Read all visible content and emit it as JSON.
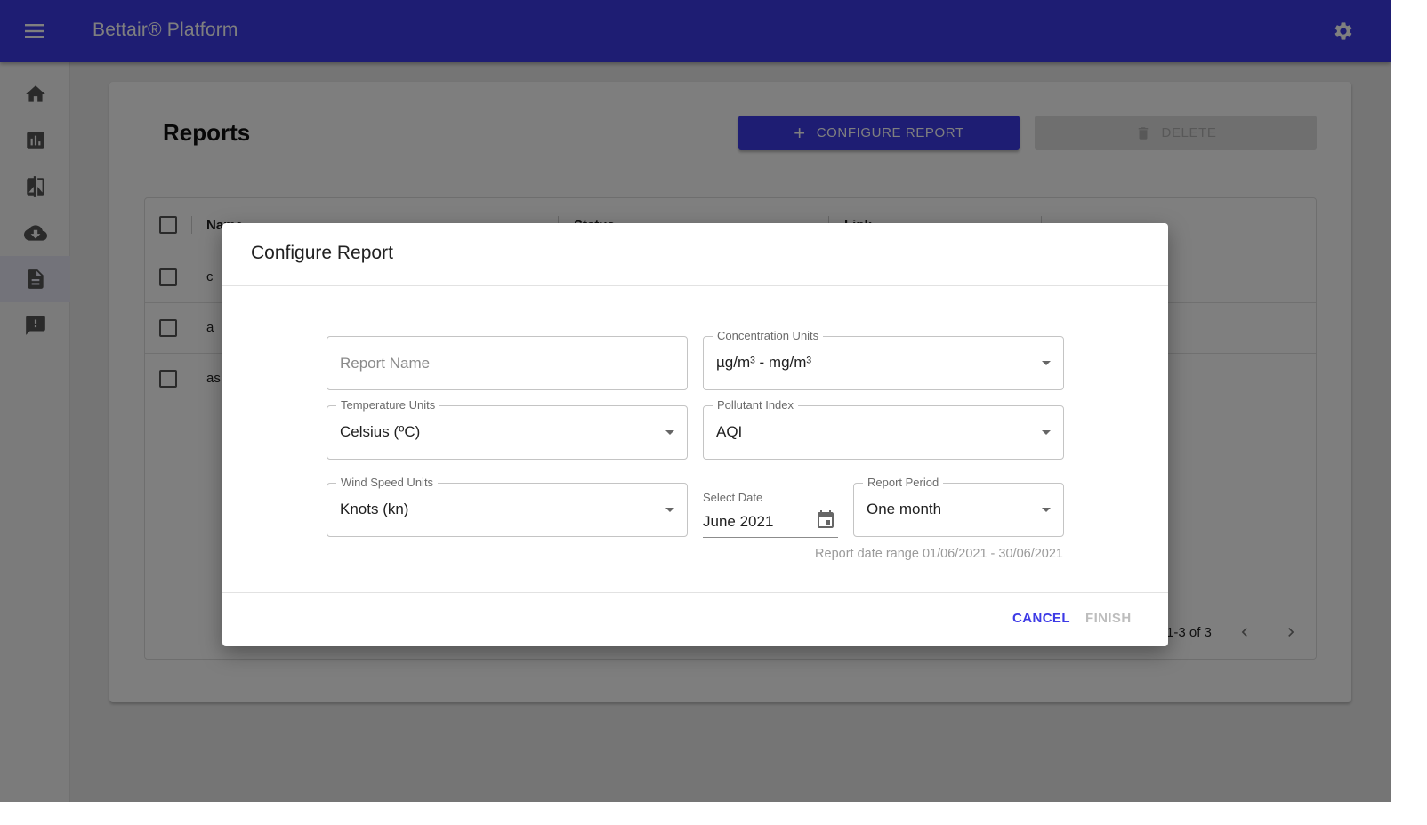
{
  "appbar": {
    "title": "Bettair® Platform",
    "menu_icon": "menu-icon",
    "settings_icon": "gear-icon"
  },
  "sidebar": {
    "items": [
      {
        "name": "home",
        "icon": "home-icon",
        "active": false
      },
      {
        "name": "charts",
        "icon": "bar-chart-icon",
        "active": false
      },
      {
        "name": "compare",
        "icon": "compare-icon",
        "active": false
      },
      {
        "name": "download",
        "icon": "cloud-download-icon",
        "active": false
      },
      {
        "name": "reports",
        "icon": "document-icon",
        "active": true
      },
      {
        "name": "alerts",
        "icon": "feedback-icon",
        "active": false
      }
    ]
  },
  "page": {
    "title": "Reports",
    "configure_button": "CONFIGURE REPORT",
    "delete_button": "DELETE",
    "table": {
      "columns": [
        "Name",
        "Status",
        "Link"
      ],
      "rows": [
        {
          "name": "c"
        },
        {
          "name": "a"
        },
        {
          "name": "as"
        }
      ],
      "pagination": "1-3 of 3"
    }
  },
  "dialog": {
    "title": "Configure Report",
    "report_name": {
      "placeholder": "Report Name",
      "value": ""
    },
    "concentration_units": {
      "label": "Concentration Units",
      "value": "µg/m³ - mg/m³"
    },
    "temperature_units": {
      "label": "Temperature Units",
      "value": "Celsius (ºC)"
    },
    "pollutant_index": {
      "label": "Pollutant Index",
      "value": "AQI"
    },
    "wind_speed_units": {
      "label": "Wind Speed Units",
      "value": "Knots (kn)"
    },
    "select_date": {
      "label": "Select Date",
      "value": "June 2021"
    },
    "report_period": {
      "label": "Report Period",
      "value": "One month"
    },
    "date_range_text": "Report date range 01/06/2021 - 30/06/2021",
    "cancel_button": "CANCEL",
    "finish_button": "FINISH"
  },
  "colors": {
    "primary": "#3d3ae6",
    "disabled_text": "#bdbdbd",
    "overlay": "rgba(0,0,0,0.5)"
  }
}
